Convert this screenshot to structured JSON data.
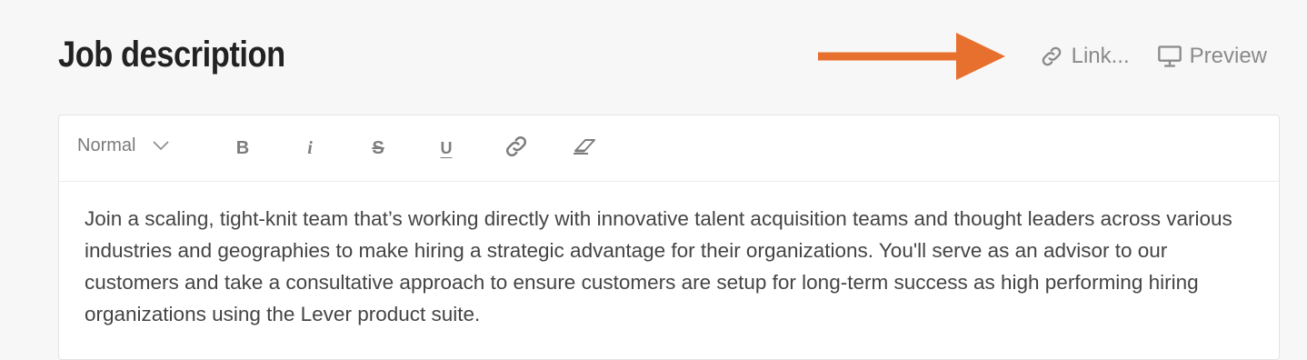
{
  "header": {
    "title": "Job description",
    "link_label": "Link...",
    "preview_label": "Preview"
  },
  "annotation": {
    "arrow_color": "#E8702E"
  },
  "editor": {
    "format_select": {
      "value": "Normal"
    },
    "toolbar": {
      "bold": "B",
      "italic": "i",
      "strikethrough": "S",
      "underline": "U"
    },
    "body_text": "Join a scaling, tight-knit team that’s working directly with innovative talent acquisition teams and thought leaders across various industries and geographies to make hiring a strategic advantage for their organizations. You'll serve as an advisor to our customers and take a consultative approach to ensure customers are setup for long-term success as high performing hiring organizations using the Lever product suite."
  },
  "colors": {
    "background": "#F7F7F7",
    "title": "#222222",
    "muted_icon": "#8A8A8A",
    "body_text": "#444444"
  }
}
